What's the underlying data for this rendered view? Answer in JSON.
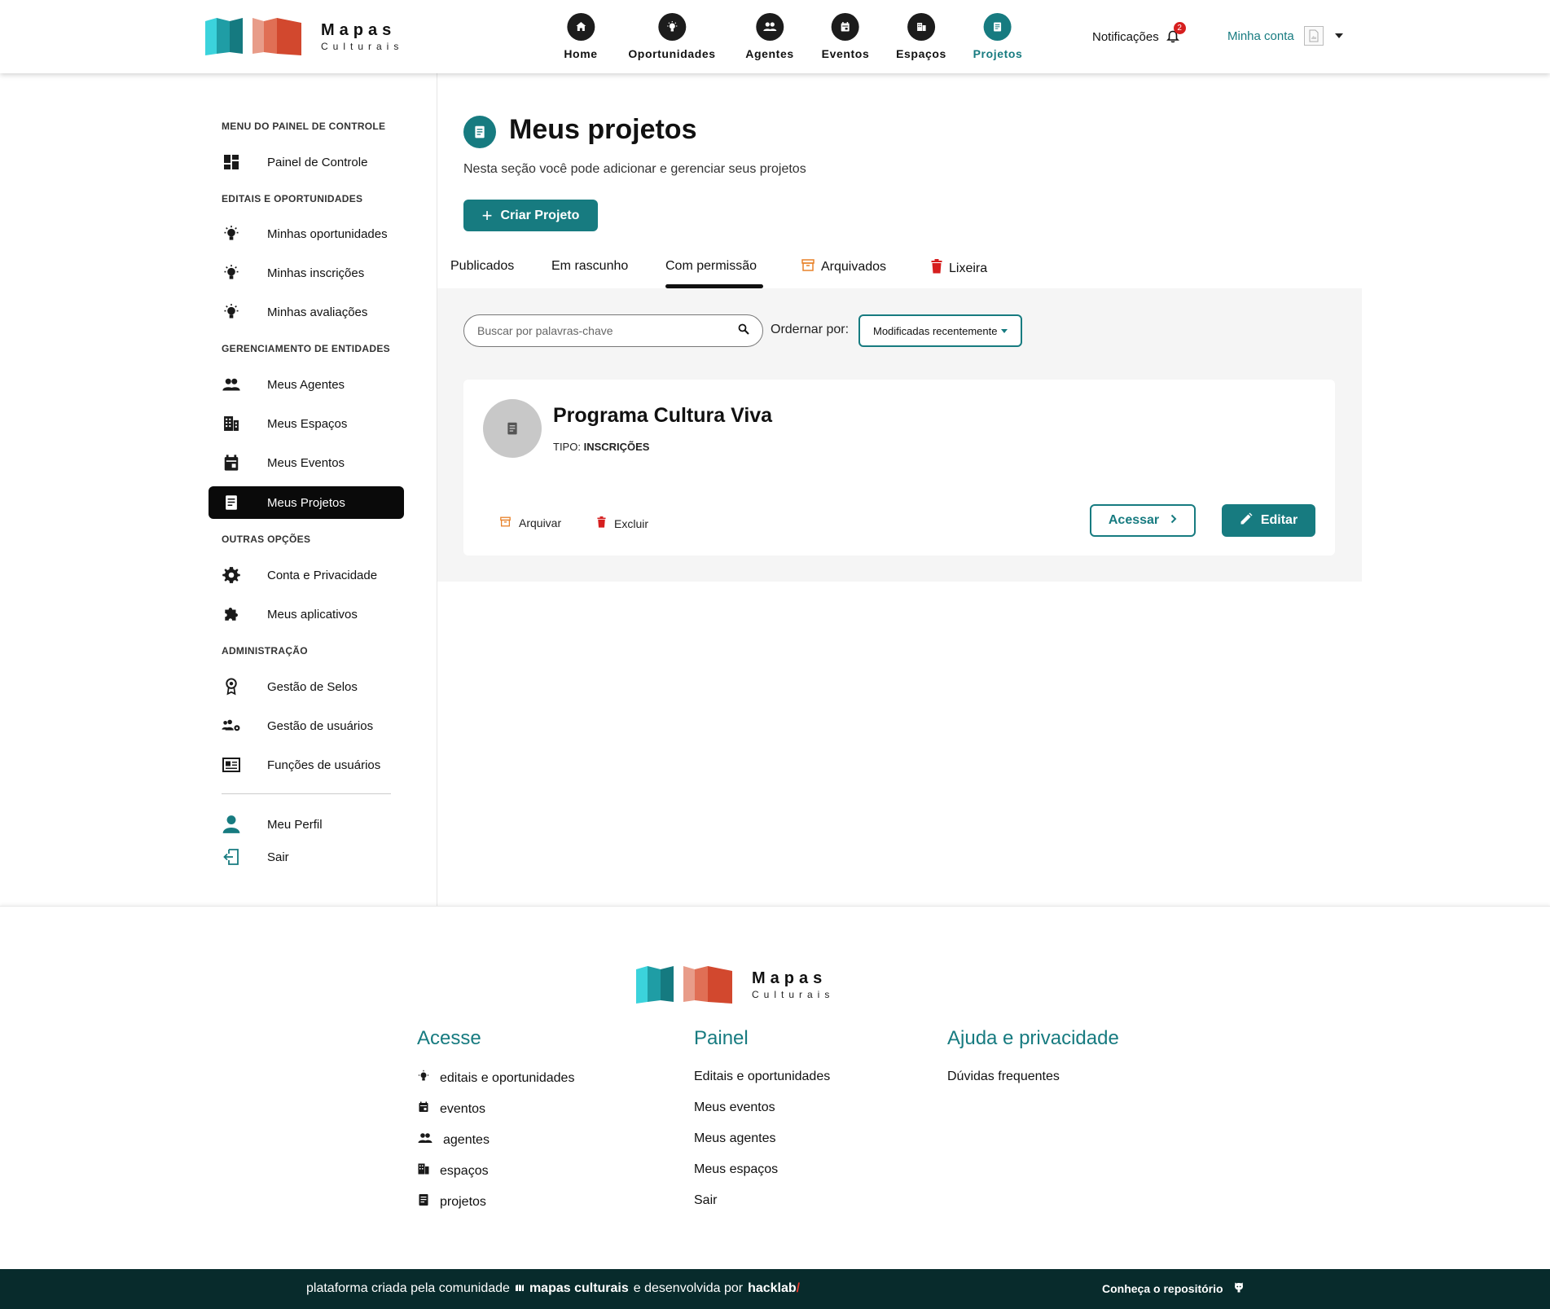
{
  "brand": {
    "name": "Mapas",
    "subtitle": "Culturais"
  },
  "nav": {
    "items": [
      {
        "label": "Home",
        "icon": "home-icon"
      },
      {
        "label": "Oportunidades",
        "icon": "lightbulb-icon"
      },
      {
        "label": "Agentes",
        "icon": "people-icon"
      },
      {
        "label": "Eventos",
        "icon": "calendar-icon"
      },
      {
        "label": "Espaços",
        "icon": "building-icon"
      },
      {
        "label": "Projetos",
        "icon": "document-icon"
      }
    ],
    "active": "Projetos",
    "notifications_label": "Notificações",
    "notifications_count": "2",
    "account_label": "Minha conta"
  },
  "sidebar": {
    "sections": [
      "MENU DO PAINEL DE CONTROLE",
      "EDITAIS E OPORTUNIDADES",
      "GERENCIAMENTO DE ENTIDADES",
      "OUTRAS OPÇÕES",
      "ADMINISTRAÇÃO"
    ],
    "items": [
      {
        "label": "Painel de Controle",
        "icon": "dashboard-icon"
      },
      {
        "label": "Minhas oportunidades",
        "icon": "lightbulb-icon"
      },
      {
        "label": "Minhas inscrições",
        "icon": "lightbulb-icon"
      },
      {
        "label": "Minhas avaliações",
        "icon": "lightbulb-icon"
      },
      {
        "label": "Meus Agentes",
        "icon": "people-icon"
      },
      {
        "label": "Meus Espaços",
        "icon": "building-icon"
      },
      {
        "label": "Meus Eventos",
        "icon": "calendar-icon"
      },
      {
        "label": "Meus Projetos",
        "icon": "document-icon"
      },
      {
        "label": "Conta e Privacidade",
        "icon": "gear-icon"
      },
      {
        "label": "Meus aplicativos",
        "icon": "puzzle-icon"
      },
      {
        "label": "Gestão de Selos",
        "icon": "seal-icon"
      },
      {
        "label": "Gestão de usuários",
        "icon": "users-gear-icon"
      },
      {
        "label": "Funções de usuários",
        "icon": "id-card-icon"
      },
      {
        "label": "Meu Perfil",
        "icon": "user-icon"
      },
      {
        "label": "Sair",
        "icon": "logout-icon"
      }
    ]
  },
  "main": {
    "title": "Meus projetos",
    "subtitle": "Nesta seção você pode adicionar e gerenciar seus projetos",
    "create_button": "Criar Projeto",
    "tabs": [
      {
        "label": "Publicados"
      },
      {
        "label": "Em rascunho"
      },
      {
        "label": "Com permissão"
      },
      {
        "label": "Arquivados",
        "icon": "archive-icon"
      },
      {
        "label": "Lixeira",
        "icon": "trash-icon"
      }
    ],
    "active_tab": "Com permissão",
    "search_placeholder": "Buscar por palavras-chave",
    "order_label": "Ordernar por:",
    "order_value": "Modificadas recentemente",
    "card": {
      "title": "Programa Cultura Viva",
      "type_label": "TIPO:",
      "type_value": "INSCRIÇÕES",
      "archive_label": "Arquivar",
      "delete_label": "Excluir",
      "access_label": "Acessar",
      "edit_label": "Editar"
    }
  },
  "footer": {
    "columns": [
      {
        "title": "Acesse",
        "links": [
          {
            "label": "editais e oportunidades",
            "icon": "lightbulb-icon"
          },
          {
            "label": "eventos",
            "icon": "calendar-icon"
          },
          {
            "label": "agentes",
            "icon": "people-icon"
          },
          {
            "label": "espaços",
            "icon": "building-icon"
          },
          {
            "label": "projetos",
            "icon": "document-icon"
          }
        ]
      },
      {
        "title": "Painel",
        "links": [
          {
            "label": "Editais e oportunidades"
          },
          {
            "label": "Meus eventos"
          },
          {
            "label": "Meus agentes"
          },
          {
            "label": "Meus espaços"
          },
          {
            "label": "Sair"
          }
        ]
      },
      {
        "title": "Ajuda e privacidade",
        "links": [
          {
            "label": "Dúvidas frequentes"
          }
        ]
      }
    ],
    "bottom_text_1": "plataforma criada pela comunidade",
    "bottom_brand": "mapas culturais",
    "bottom_text_2": "e desenvolvida por",
    "bottom_dev": "hacklab",
    "bottom_slash": "/",
    "repo_label": "Conheça o repositório"
  },
  "colors": {
    "accent": "#177b80",
    "dark": "#082b2c",
    "danger": "#d61f1f",
    "archive": "#e8822a"
  }
}
